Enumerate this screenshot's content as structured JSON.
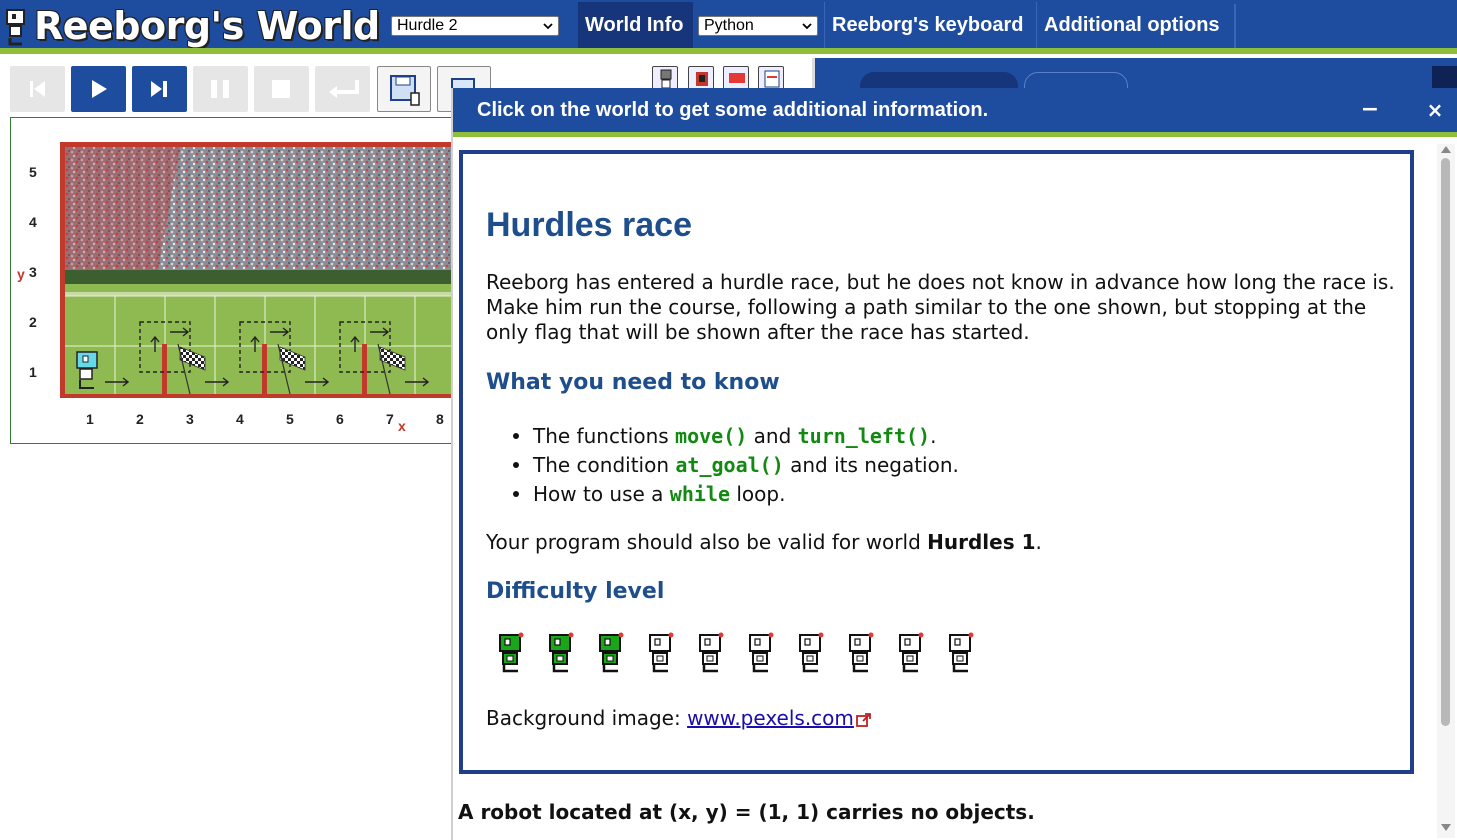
{
  "app": {
    "title": "Reeborg's World"
  },
  "header": {
    "world_select": "Hurdle 2",
    "world_info_label": "World Info",
    "language_select": "Python",
    "keyboard_label": "Reeborg's keyboard",
    "options_label": "Additional options"
  },
  "colors": {
    "header_blue": "#1e4c9e",
    "accent_green": "#8fbf3a",
    "heading_blue": "#1f4e8c",
    "code_green": "#128a12"
  },
  "world": {
    "x_ticks": [
      "1",
      "2",
      "3",
      "4",
      "5",
      "6",
      "7",
      "8"
    ],
    "y_ticks": [
      "5",
      "4",
      "3",
      "2",
      "1"
    ],
    "x_label": "x",
    "y_label": "y",
    "robot": {
      "x": 1,
      "y": 1
    }
  },
  "dialog": {
    "title": "Click on the world to get some additional information.",
    "minimize": "−",
    "close": "×",
    "heading": "Hurdles race",
    "intro": [
      "Reeborg has entered a hurdle race, but he does not know in advance how long the race is.",
      "Make him run the course, following a path similar to the one shown, but stopping at the",
      "only flag that will be shown after the race has started."
    ],
    "know_heading": "What you need to know",
    "bullets": {
      "b1_pre": "The functions ",
      "b1_code1": "move()",
      "b1_mid": " and ",
      "b1_code2": "turn_left()",
      "b1_post": ".",
      "b2_pre": "The condition ",
      "b2_code": "at_goal()",
      "b2_post": " and its negation.",
      "b3_pre": "How to use a ",
      "b3_code": "while",
      "b3_post": " loop."
    },
    "valid_pre": "Your program should also be valid for world ",
    "valid_bold": "Hurdles 1",
    "valid_post": ".",
    "difficulty_heading": "Difficulty level",
    "difficulty": {
      "level": 3,
      "max": 10
    },
    "bg_pre": "Background image: ",
    "bg_link": "www.pexels.com",
    "robot_info": "A robot located at (x, y) = (1, 1) carries no objects."
  }
}
